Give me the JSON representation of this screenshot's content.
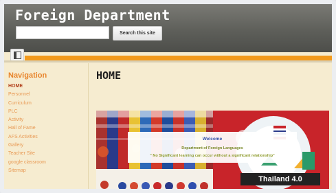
{
  "header": {
    "site_title": "Foreign Department",
    "search_placeholder": "",
    "search_button": "Search this site"
  },
  "sidebar": {
    "heading": "Navigation",
    "items": [
      {
        "label": "HOME",
        "active": true
      },
      {
        "label": "Personnel",
        "active": false
      },
      {
        "label": "Curriculum",
        "active": false
      },
      {
        "label": "PLC",
        "active": false
      },
      {
        "label": "Activity",
        "active": false
      },
      {
        "label": "Hall of Fame",
        "active": false
      },
      {
        "label": "AFS Activities",
        "active": false
      },
      {
        "label": "Gallery",
        "active": false
      },
      {
        "label": "Teacher Site",
        "active": false
      },
      {
        "label": "google classroom",
        "active": false
      },
      {
        "label": "Sitemap",
        "active": false
      }
    ]
  },
  "main": {
    "page_title": "HOME",
    "banner": {
      "welcome_title": "Welcome",
      "department": "Department of Foreign Languages",
      "quote": "\" No Significant learning can occur without a significant relationship\"",
      "thailand_label": "Thailand 4.0"
    }
  },
  "colors": {
    "header_bg": "#5e5f5a",
    "accent_orange": "#f39a1c",
    "page_bg": "#f6ecd0",
    "nav_heading": "#e8842a",
    "nav_link": "#e89a55",
    "nav_active": "#b3441f"
  },
  "icons": {
    "sidebar_toggle": "sidebar-toggle-icon"
  }
}
